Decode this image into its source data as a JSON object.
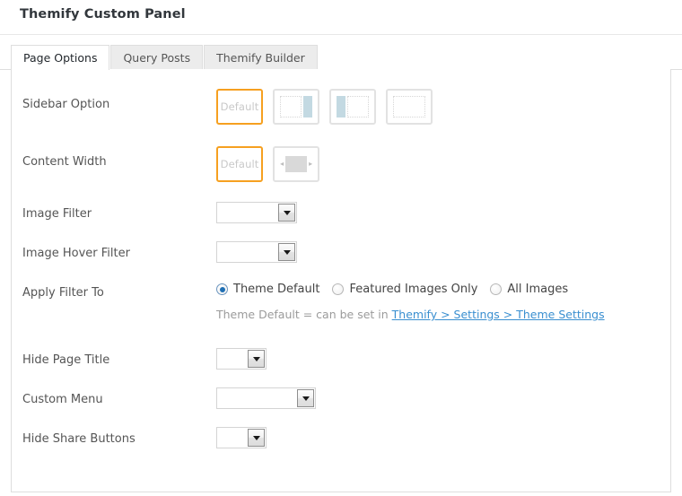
{
  "panel": {
    "title": "Themify Custom Panel"
  },
  "tabs": [
    {
      "label": "Page Options",
      "active": true
    },
    {
      "label": "Query Posts",
      "active": false
    },
    {
      "label": "Themify Builder",
      "active": false
    }
  ],
  "rows": {
    "sidebar_option": {
      "label": "Sidebar Option",
      "options": [
        {
          "name": "default",
          "text": "Default",
          "selected": true
        },
        {
          "name": "sidebar-right",
          "text": "",
          "selected": false
        },
        {
          "name": "sidebar-left",
          "text": "",
          "selected": false
        },
        {
          "name": "full-width",
          "text": "",
          "selected": false
        }
      ]
    },
    "content_width": {
      "label": "Content Width",
      "options": [
        {
          "name": "default",
          "text": "Default",
          "selected": true
        },
        {
          "name": "full-width-bar",
          "text": "",
          "selected": false
        }
      ]
    },
    "image_filter": {
      "label": "Image Filter",
      "value": "",
      "options": []
    },
    "image_hover_filter": {
      "label": "Image Hover Filter",
      "value": "",
      "options": []
    },
    "apply_filter_to": {
      "label": "Apply Filter To",
      "radios": [
        {
          "label": "Theme Default",
          "checked": true
        },
        {
          "label": "Featured Images Only",
          "checked": false
        },
        {
          "label": "All Images",
          "checked": false
        }
      ],
      "helper_prefix": "Theme Default = can be set in ",
      "helper_link": "Themify > Settings > Theme Settings"
    },
    "hide_page_title": {
      "label": "Hide Page Title",
      "value": ""
    },
    "custom_menu": {
      "label": "Custom Menu",
      "value": ""
    },
    "hide_share_buttons": {
      "label": "Hide Share Buttons",
      "value": ""
    }
  },
  "annotations": {
    "arrows": [
      {
        "name": "arrow-image-filter",
        "target": "Image Filter dropdown",
        "color": "#e01b22"
      },
      {
        "name": "arrow-image-hover-filter",
        "target": "Image Hover Filter dropdown",
        "color": "#e01b22"
      },
      {
        "name": "arrow-all-images",
        "target": "All Images radio",
        "color": "#e01b22"
      }
    ]
  }
}
